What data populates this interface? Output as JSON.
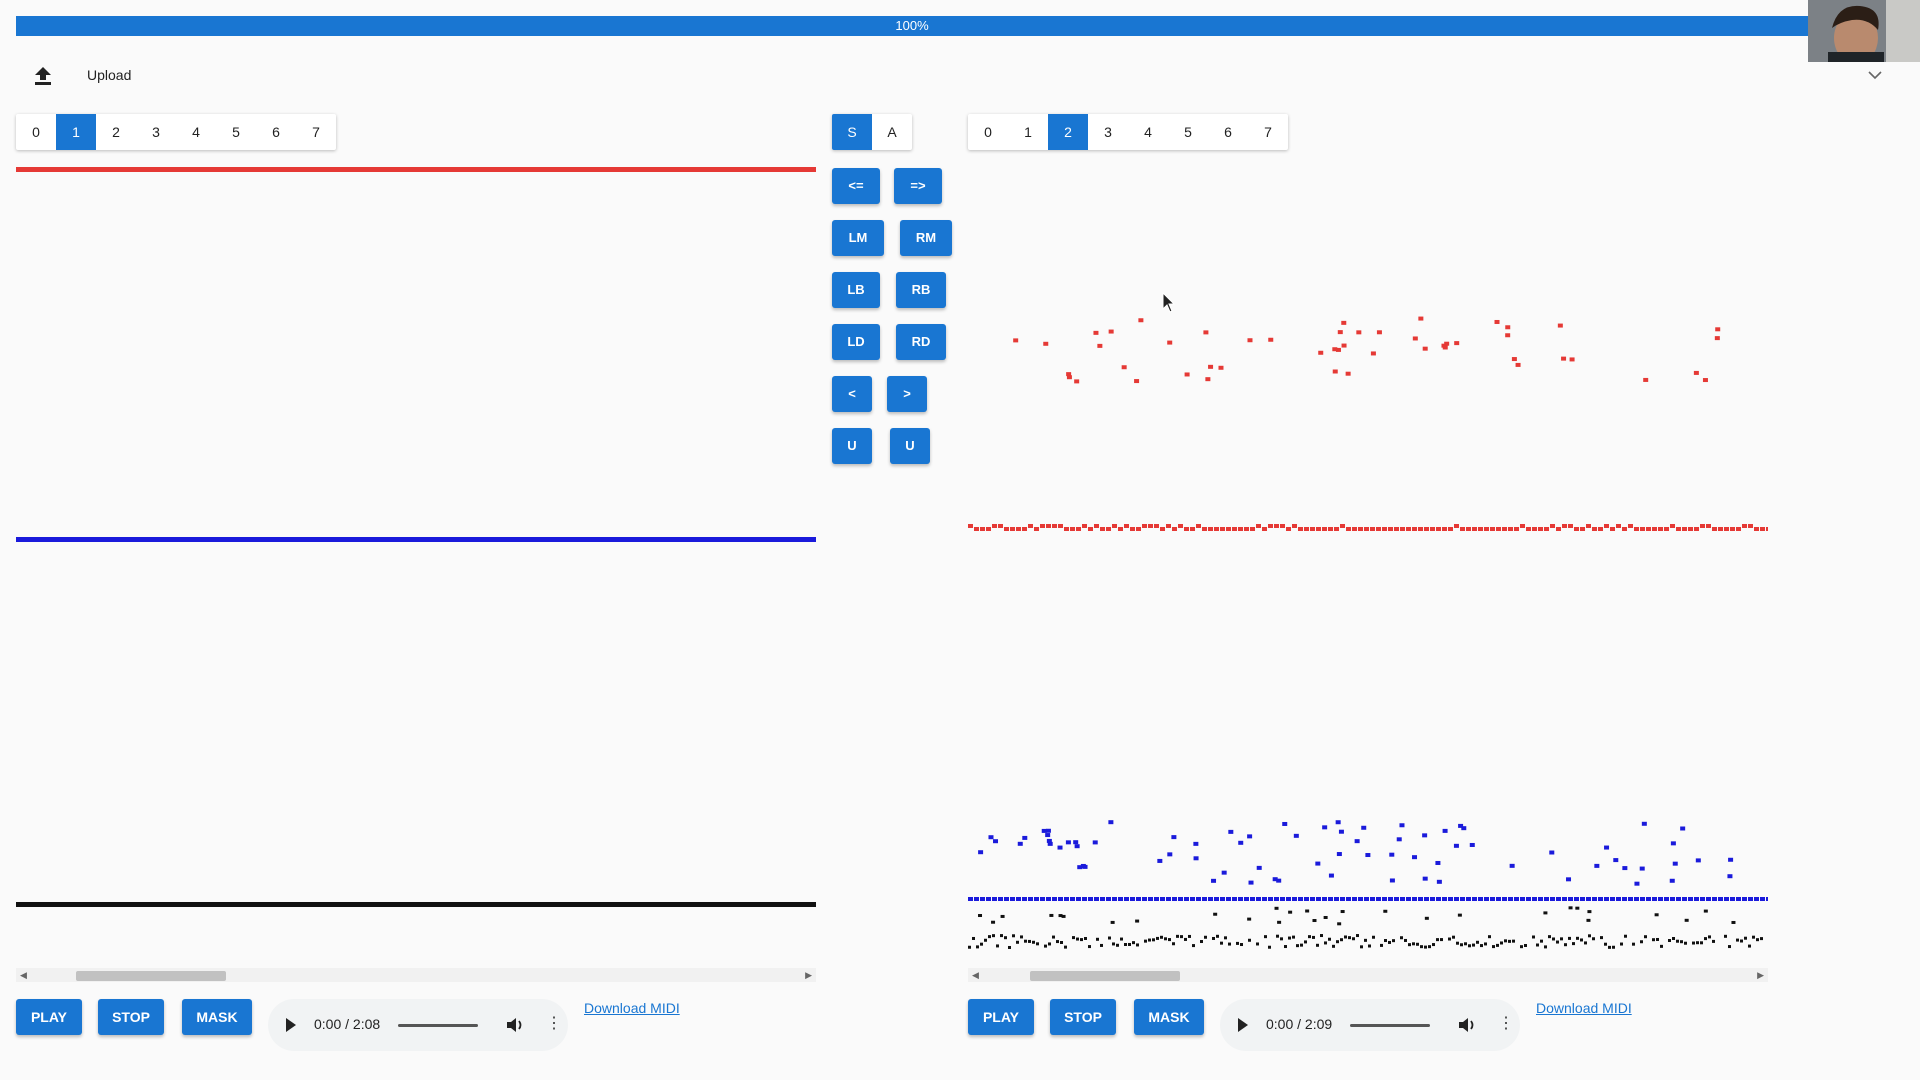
{
  "progress": {
    "label": "100%",
    "value": 1.0
  },
  "toolbar": {
    "upload_label": "Upload",
    "upload_icon": "upload-icon",
    "collapse_icon": "chevron-down-icon"
  },
  "left_tabs": [
    "0",
    "1",
    "2",
    "3",
    "4",
    "5",
    "6",
    "7"
  ],
  "left_selected": 1,
  "right_tabs": [
    "0",
    "1",
    "2",
    "3",
    "4",
    "5",
    "6",
    "7"
  ],
  "right_selected": 2,
  "mode": {
    "s": "S",
    "a": "A",
    "selected": "S"
  },
  "controls": {
    "prev_label": "<=",
    "next_label": "=>",
    "lm": "LM",
    "rm": "RM",
    "lb": "LB",
    "rb": "RB",
    "ld": "LD",
    "rd": "RD",
    "lt": "<",
    "gt": ">",
    "u1": "U",
    "u2": "U"
  },
  "colors": {
    "accent": "#1976d2",
    "red_track": "#e53935",
    "blue_track": "#1a1adb",
    "black_track": "#111111"
  },
  "left_player": {
    "play": "PLAY",
    "stop": "STOP",
    "mask": "MASK",
    "time": "0:00 / 2:08",
    "download": "Download MIDI"
  },
  "right_player": {
    "play": "PLAY",
    "stop": "STOP",
    "mask": "MASK",
    "time": "0:00 / 2:09",
    "download": "Download MIDI"
  }
}
